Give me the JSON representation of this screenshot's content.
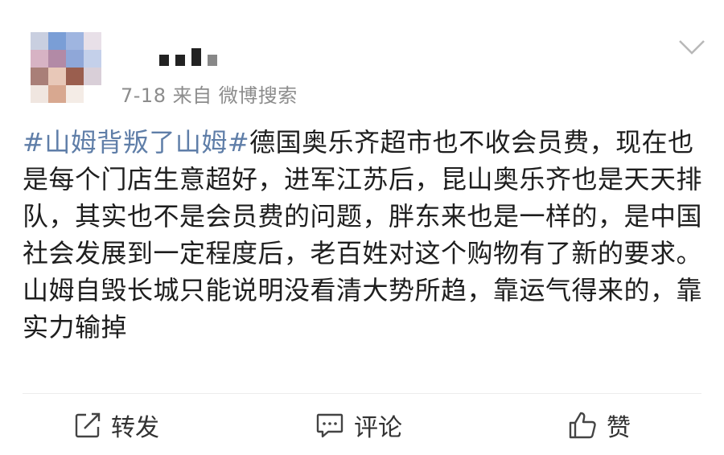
{
  "post": {
    "meta": "7-18  来自 微博搜索",
    "topic": "#山姆背叛了山姆#",
    "text": "德国奥乐齐超市也不收会员费，现在也是每个门店生意超好，进军江苏后，昆山奥乐齐也是天天排队，其实也不是会员费的问题，胖东来也是一样的，是中国社会发展到一定程度后，老百姓对这个购物有了新的要求。山姆自毁长城只能说明没看清大势所趋，靠运气得来的，靠实力输掉"
  },
  "actions": {
    "repost": "转发",
    "comment": "评论",
    "like": "赞"
  },
  "colors": {
    "topic": "#5f7ea8",
    "meta": "#8c8c8c"
  },
  "icons": [
    "chevron-down-icon",
    "repost-icon",
    "comment-icon",
    "thumbs-up-icon"
  ]
}
